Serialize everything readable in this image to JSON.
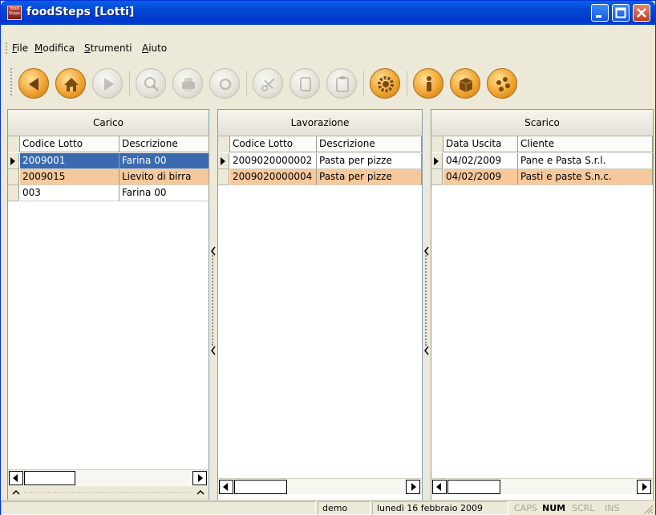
{
  "window": {
    "title": "foodSteps [Lotti]",
    "app_icon_text": "food Steps"
  },
  "menu": [
    "File",
    "Modifica",
    "Strumenti",
    "Aiuto"
  ],
  "toolbar": {
    "buttons": [
      {
        "name": "back",
        "state": "enabled"
      },
      {
        "name": "home",
        "state": "enabled"
      },
      {
        "name": "forward",
        "state": "disabled"
      },
      {
        "name": "search",
        "state": "disabled"
      },
      {
        "name": "print",
        "state": "disabled"
      },
      {
        "name": "refresh",
        "state": "disabled"
      },
      {
        "name": "cut",
        "state": "disabled"
      },
      {
        "name": "copy",
        "state": "disabled"
      },
      {
        "name": "paste",
        "state": "disabled"
      },
      {
        "name": "settings",
        "state": "enabled"
      },
      {
        "name": "info",
        "state": "enabled"
      },
      {
        "name": "box",
        "state": "enabled"
      },
      {
        "name": "palette",
        "state": "enabled"
      }
    ]
  },
  "panels": {
    "carico": {
      "title": "Carico",
      "columns": [
        "Codice Lotto",
        "Descrizione"
      ],
      "rows": [
        {
          "codice": "2009001",
          "descrizione": "Farina 00",
          "highlight": "selected-blue",
          "current": true
        },
        {
          "codice": "2009015",
          "descrizione": "Lievito di birra",
          "highlight": "orange",
          "current": false
        },
        {
          "codice": "003",
          "descrizione": "Farina 00",
          "highlight": "none",
          "current": false
        }
      ]
    },
    "lavorazione": {
      "title": "Lavorazione",
      "columns": [
        "Codice Lotto",
        "Descrizione"
      ],
      "rows": [
        {
          "codice": "2009020000002",
          "descrizione": "Pasta per pizze",
          "highlight": "none",
          "current": true
        },
        {
          "codice": "2009020000004",
          "descrizione": "Pasta per pizze",
          "highlight": "orange",
          "current": false
        }
      ]
    },
    "scarico": {
      "title": "Scarico",
      "columns": [
        "Data Uscita",
        "Cliente"
      ],
      "rows": [
        {
          "data": "04/02/2009",
          "cliente": "Pane e Pasta S.r.l.",
          "highlight": "none",
          "current": true
        },
        {
          "data": "04/02/2009",
          "cliente": "Pasti e paste S.n.c.",
          "highlight": "orange",
          "current": false
        }
      ]
    }
  },
  "status": {
    "user": "demo",
    "date": "lunedì 16 febbraio 2009",
    "keys": [
      {
        "label": "CAPS",
        "on": false
      },
      {
        "label": "NUM",
        "on": true
      },
      {
        "label": "SCRL",
        "on": false
      },
      {
        "label": "INS",
        "on": false
      }
    ]
  },
  "colors": {
    "title_bar": "#0246d4",
    "selection_blue": "#3a6ab0",
    "highlight_orange": "#f6c99c",
    "accent_orange": "#f0a432"
  }
}
